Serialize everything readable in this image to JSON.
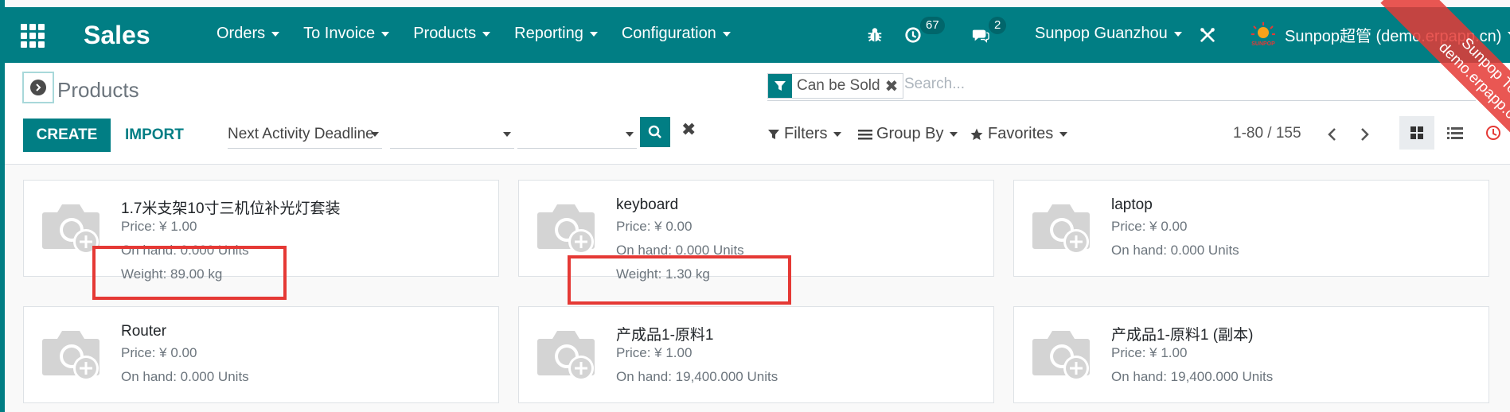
{
  "navbar": {
    "app_name": "Sales",
    "menu": [
      "Orders",
      "To Invoice",
      "Products",
      "Reporting",
      "Configuration"
    ],
    "activity_count": "67",
    "message_count": "2",
    "company": "Sunpop Guanzhou",
    "company_logo_text": "SUNPOP",
    "user": "Sunpop超管 (demo.erpapp.cn)"
  },
  "ribbon": {
    "line1": "Sunpop Test",
    "line2": "demo.erpapp.cn"
  },
  "control_panel": {
    "breadcrumb": "Products",
    "facet_label": "Can be Sold",
    "search_placeholder": "Search...",
    "create_label": "CREATE",
    "import_label": "IMPORT",
    "sort_select_value": "Next Activity Deadline",
    "filters_label": "Filters",
    "group_by_label": "Group By",
    "favorites_label": "Favorites",
    "pager": "1-80 / 155"
  },
  "products": [
    {
      "name": "1.7米支架10寸三机位补光灯套装",
      "price": "Price: ¥ 1.00",
      "on_hand": "On hand: 0.000 Units",
      "weight": "Weight: 89.00 kg"
    },
    {
      "name": "keyboard",
      "price": "Price: ¥ 0.00",
      "on_hand": "On hand: 0.000 Units",
      "weight": "Weight: 1.30 kg"
    },
    {
      "name": "laptop",
      "price": "Price: ¥ 0.00",
      "on_hand": "On hand: 0.000 Units"
    },
    {
      "name": "Router",
      "price": "Price: ¥ 0.00",
      "on_hand": "On hand: 0.000 Units"
    },
    {
      "name": "产成品1-原料1",
      "price": "Price: ¥ 1.00",
      "on_hand": "On hand: 19,400.000 Units"
    },
    {
      "name": "产成品1-原料1 (副本)",
      "price": "Price: ¥ 1.00",
      "on_hand": "On hand: 19,400.000 Units"
    }
  ],
  "colors": {
    "primary": "#017e84",
    "highlight": "#e53935",
    "ribbon": "#e53935"
  },
  "icons": [
    "apps-grid-icon",
    "bug-icon",
    "clock-icon",
    "chat-icon",
    "tools-icon",
    "toggle-arrow-icon",
    "filter-funnel-icon",
    "search-icon",
    "close-icon",
    "bars-icon",
    "star-icon",
    "chevron-left-icon",
    "chevron-right-icon",
    "kanban-view-icon",
    "list-view-icon",
    "activity-view-icon",
    "camera-placeholder-icon"
  ]
}
